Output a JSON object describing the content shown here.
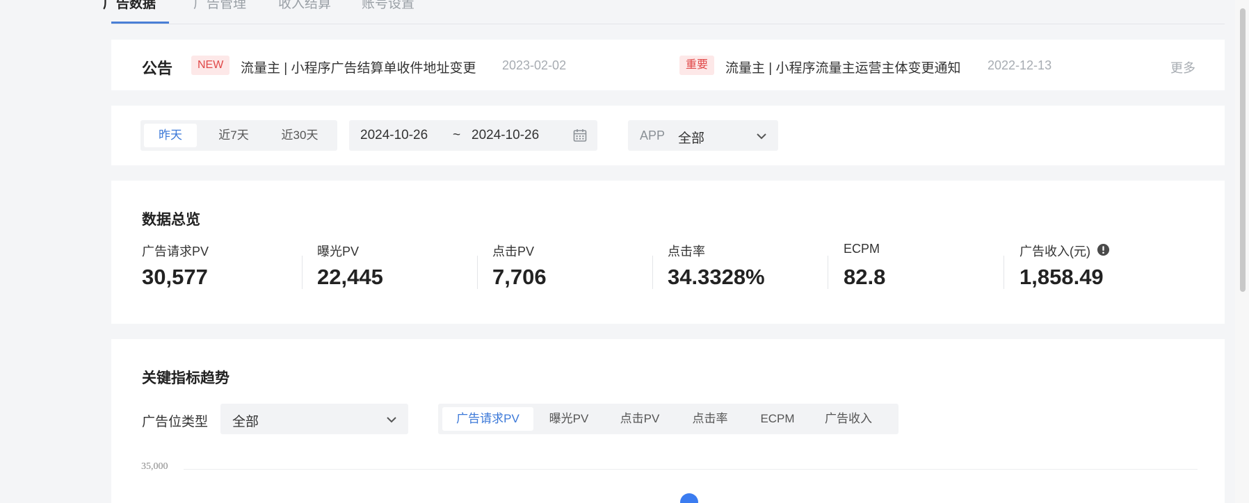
{
  "top_tabs": [
    "广告数据",
    "广告管理",
    "收入结算",
    "账号设置"
  ],
  "notice": {
    "title": "公告",
    "items": [
      {
        "tag": "NEW",
        "text": "流量主 | 小程序广告结算单收件地址变更",
        "date": "2023-02-02"
      },
      {
        "tag": "重要",
        "text": "流量主 | 小程序流量主运营主体变更通知",
        "date": "2022-12-13"
      }
    ],
    "more": "更多"
  },
  "filters": {
    "range_options": [
      "昨天",
      "近7天",
      "近30天"
    ],
    "range_selected": "昨天",
    "start_date": "2024-10-26",
    "separator": "~",
    "end_date": "2024-10-26",
    "app_label": "APP",
    "app_value": "全部"
  },
  "overview": {
    "title": "数据总览",
    "metrics": [
      {
        "label": "广告请求PV",
        "value": "30,577"
      },
      {
        "label": "曝光PV",
        "value": "22,445"
      },
      {
        "label": "点击PV",
        "value": "7,706"
      },
      {
        "label": "点击率",
        "value": "34.3328%"
      },
      {
        "label": "ECPM",
        "value": "82.8"
      },
      {
        "label": "广告收入(元)",
        "value": "1,858.49"
      }
    ]
  },
  "trend": {
    "title": "关键指标趋势",
    "type_label": "广告位类型",
    "type_value": "全部",
    "metric_tabs": [
      "广告请求PV",
      "曝光PV",
      "点击PV",
      "点击率",
      "ECPM",
      "广告收入"
    ],
    "metric_selected": "广告请求PV",
    "y_tick_top": "35,000"
  },
  "colors": {
    "accent": "#3b78d8",
    "tag_bg": "#fde8e8",
    "tag_text": "#e04848",
    "data_point": "#3b7cf0"
  },
  "icons": {
    "calendar": "calendar-icon",
    "chevron": "chevron-down-icon",
    "info": "info-icon"
  }
}
